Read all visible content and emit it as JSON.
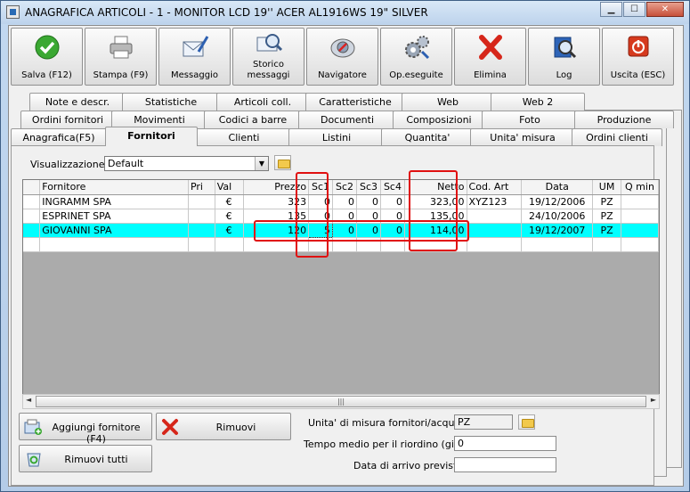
{
  "window": {
    "title": "ANAGRAFICA ARTICOLI - 1 - MONITOR LCD 19'' ACER AL1916WS 19\" SILVER"
  },
  "toolbar": [
    {
      "label": "Salva (F12)",
      "icon": "check-icon"
    },
    {
      "label": "Stampa (F9)",
      "icon": "printer-icon"
    },
    {
      "label": "Messaggio",
      "icon": "message-icon"
    },
    {
      "label": "Storico messaggi",
      "icon": "history-icon"
    },
    {
      "label": "Navigatore",
      "icon": "navigator-icon"
    },
    {
      "label": "Op.eseguite",
      "icon": "gears-icon"
    },
    {
      "label": "Elimina",
      "icon": "delete-icon"
    },
    {
      "label": "Log",
      "icon": "log-icon"
    },
    {
      "label": "Uscita (ESC)",
      "icon": "exit-icon"
    }
  ],
  "tabs": {
    "row1": [
      "Note e descr.",
      "Statistiche",
      "Articoli coll.",
      "Caratteristiche",
      "Web",
      "Web 2"
    ],
    "row2": [
      "Ordini fornitori",
      "Movimenti",
      "Codici a barre",
      "Documenti",
      "Composizioni",
      "Foto",
      "Produzione"
    ],
    "row3": [
      "Anagrafica(F5)",
      "Fornitori",
      "Clienti",
      "Listini",
      "Quantita'",
      "Unita' misura",
      "Ordini clienti"
    ],
    "active": "Fornitori"
  },
  "view": {
    "label": "Visualizzazione :",
    "value": "Default"
  },
  "grid": {
    "columns": [
      "Fornitore",
      "Pri",
      "Val",
      "Prezzo",
      "Sc1",
      "Sc2",
      "Sc3",
      "Sc4",
      "Netto",
      "Cod. Art",
      "Data",
      "UM",
      "Q min"
    ],
    "rows": [
      [
        "INGRAMM SPA",
        "",
        "€",
        "323",
        "0",
        "0",
        "0",
        "0",
        "323,00",
        "XYZ123",
        "19/12/2006",
        "PZ",
        ""
      ],
      [
        "ESPRINET SPA",
        "",
        "€",
        "135",
        "0",
        "0",
        "0",
        "0",
        "135,00",
        "",
        "24/10/2006",
        "PZ",
        ""
      ],
      [
        "GIOVANNI SPA",
        "",
        "€",
        "120",
        "5",
        "0",
        "0",
        "0",
        "114,00",
        "",
        "19/12/2007",
        "PZ",
        ""
      ]
    ],
    "selected_row": 2
  },
  "buttons": {
    "add": "Aggiungi fornitore (F4)",
    "remove": "Rimuovi",
    "remove_all": "Rimuovi tutti"
  },
  "fields": {
    "um_label": "Unita' di misura fornitori/acquisto :",
    "um_value": "PZ",
    "tempo_label": "Tempo medio per il riordino (giorni) :",
    "tempo_value": "0",
    "data_label": "Data di arrivo prevista :",
    "data_value": ""
  }
}
